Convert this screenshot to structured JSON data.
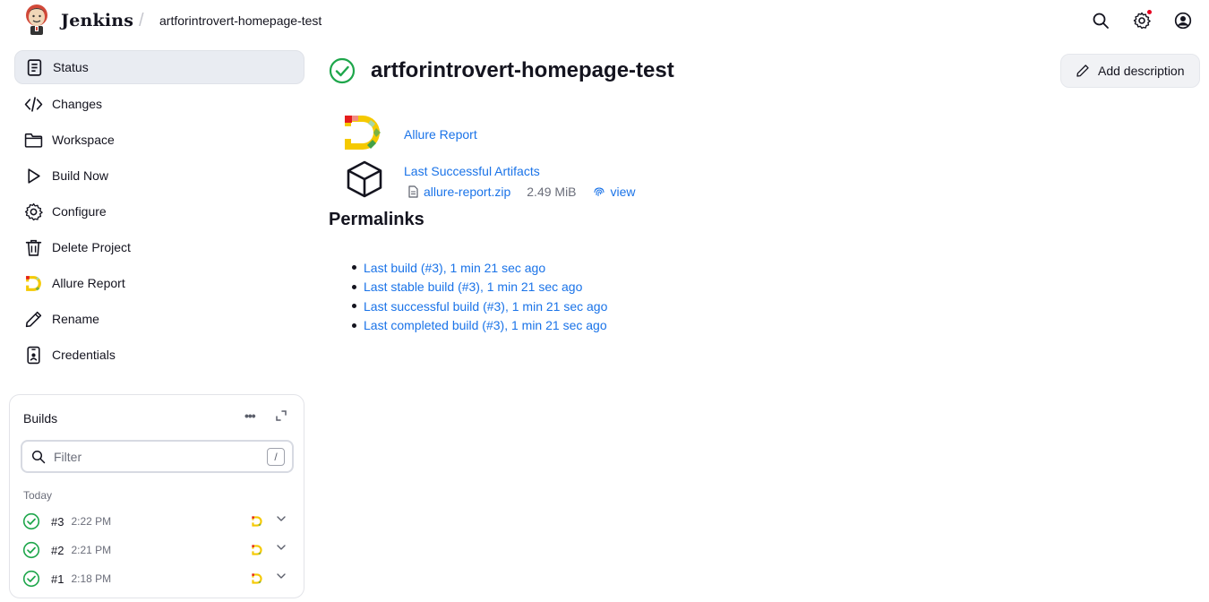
{
  "header": {
    "brand": "Jenkins",
    "breadcrumb_separator": "/",
    "breadcrumb_job": "artforintrovert-homepage-test",
    "icons": [
      "search-icon",
      "gear-icon",
      "user-icon"
    ],
    "notification_color": "#e6001f"
  },
  "sidebar": {
    "items": [
      {
        "label": "Status",
        "icon": "document-icon",
        "active": true
      },
      {
        "label": "Changes",
        "icon": "code-icon"
      },
      {
        "label": "Workspace",
        "icon": "folder-icon"
      },
      {
        "label": "Build Now",
        "icon": "play-icon"
      },
      {
        "label": "Configure",
        "icon": "gear-icon"
      },
      {
        "label": "Delete Project",
        "icon": "trash-icon"
      },
      {
        "label": "Allure Report",
        "icon": "allure-icon"
      },
      {
        "label": "Rename",
        "icon": "pencil-icon"
      },
      {
        "label": "Credentials",
        "icon": "id-card-icon"
      }
    ]
  },
  "builds": {
    "title": "Builds",
    "filter_placeholder": "Filter",
    "filter_shortcut": "/",
    "group_label": "Today",
    "rows": [
      {
        "number": "#3",
        "time": "2:22 PM"
      },
      {
        "number": "#2",
        "time": "2:21 PM"
      },
      {
        "number": "#1",
        "time": "2:18 PM"
      }
    ]
  },
  "main": {
    "title": "artforintrovert-homepage-test",
    "add_description": "Add description",
    "allure_report_link": "Allure Report",
    "artifacts_link": "Last Successful Artifacts",
    "artifact": {
      "name": "allure-report.zip",
      "size": "2.49 MiB",
      "view": "view"
    },
    "permalinks_heading": "Permalinks",
    "permalinks": [
      "Last build (#3), 1 min 21 sec ago",
      "Last stable build (#3), 1 min 21 sec ago",
      "Last successful build (#3), 1 min 21 sec ago",
      "Last completed build (#3), 1 min 21 sec ago"
    ]
  },
  "colors": {
    "link": "#1a73e8",
    "success": "#1ea64b",
    "active_bg": "#e9ecf2"
  }
}
